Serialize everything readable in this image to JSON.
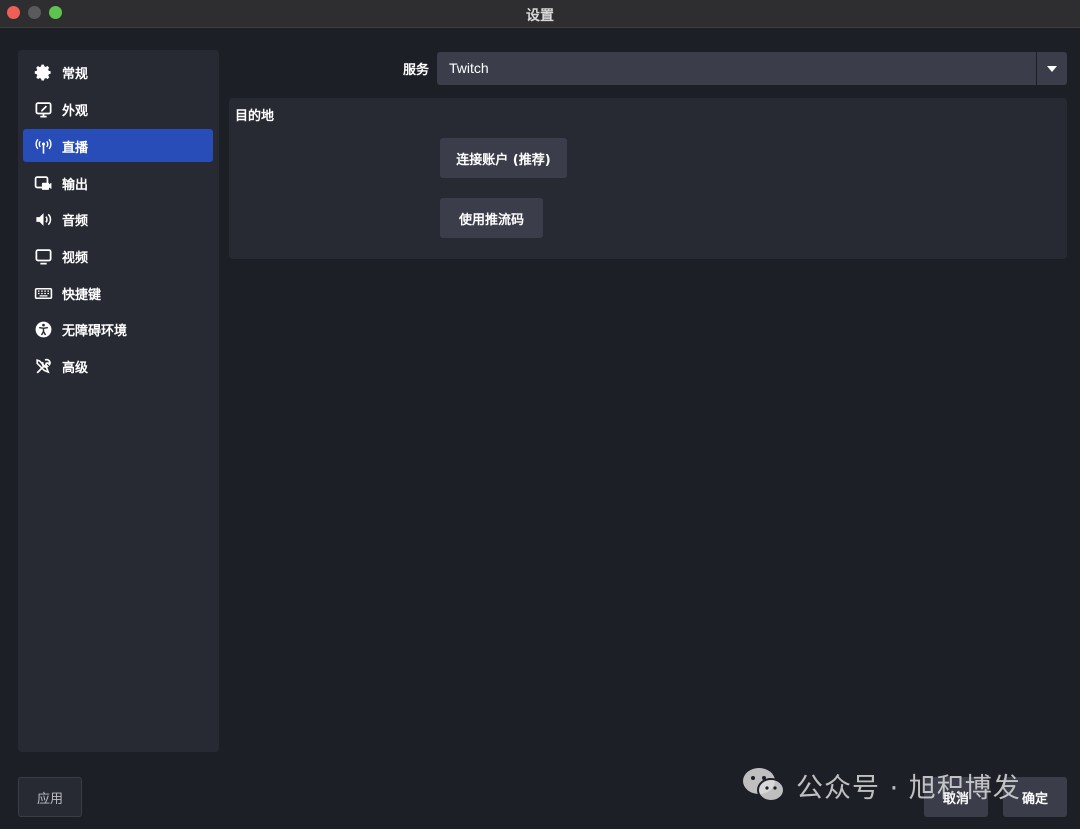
{
  "window": {
    "title": "设置"
  },
  "sidebar": {
    "items": [
      {
        "label": "常规",
        "icon": "gear-icon",
        "active": false
      },
      {
        "label": "外观",
        "icon": "appearance-icon",
        "active": false
      },
      {
        "label": "直播",
        "icon": "broadcast-icon",
        "active": true
      },
      {
        "label": "输出",
        "icon": "output-icon",
        "active": false
      },
      {
        "label": "音频",
        "icon": "speaker-icon",
        "active": false
      },
      {
        "label": "视频",
        "icon": "monitor-icon",
        "active": false
      },
      {
        "label": "快捷键",
        "icon": "keyboard-icon",
        "active": false
      },
      {
        "label": "无障碍环境",
        "icon": "accessibility-icon",
        "active": false
      },
      {
        "label": "高级",
        "icon": "tools-icon",
        "active": false
      }
    ]
  },
  "service": {
    "label": "服务",
    "value": "Twitch"
  },
  "destination": {
    "title": "目的地",
    "connect_label": "连接账户 (推荐)",
    "streamkey_label": "使用推流码"
  },
  "footer": {
    "apply_label": "应用",
    "cancel_label": "取消",
    "ok_label": "确定"
  },
  "watermark": {
    "text": "公众号 · 旭积博发"
  },
  "colors": {
    "background": "#1d1f27",
    "panel": "#272a33",
    "control": "#3b3e4a",
    "accent": "#284cb8"
  }
}
